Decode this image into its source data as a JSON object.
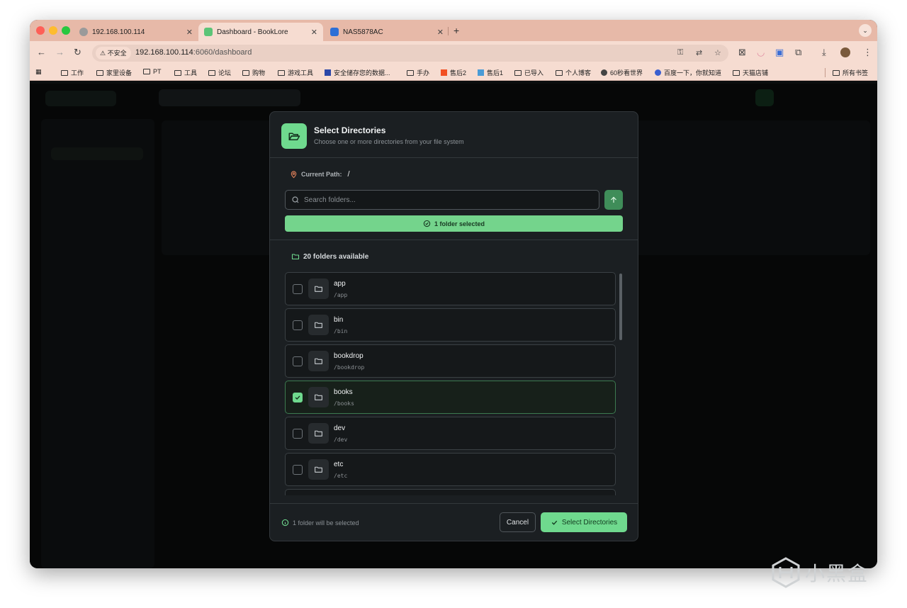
{
  "browser": {
    "tabs": [
      {
        "title": "192.168.100.114",
        "favicon": "globe-icon"
      },
      {
        "title": "Dashboard - BookLore",
        "favicon": "booklore-icon"
      },
      {
        "title": "NAS5878AC",
        "favicon": "nas-icon"
      }
    ],
    "new_tab": "+",
    "address": {
      "security_label": "不安全",
      "url_host": "192.168.100.114",
      "url_rest": ":6060/dashboard"
    },
    "bookmarks": [
      "工作",
      "家里设备",
      "PT",
      "工具",
      "论坛",
      "购物",
      "游戏工具",
      "安全储存您的数据...",
      "手办",
      "售后2",
      "售后1",
      "已导入",
      "个人博客",
      "60秒看世界",
      "百度一下，你就知道",
      "天猫店铺"
    ],
    "all_bookmarks": "所有书签"
  },
  "modal": {
    "title": "Select Directories",
    "subtitle": "Choose one or more directories from your file system",
    "current_path_label": "Current Path:",
    "current_path": "/",
    "search_placeholder": "Search folders...",
    "selected_banner": "1 folder selected",
    "available_label": "20 folders available",
    "folders": [
      {
        "name": "app",
        "path": "/app",
        "checked": false
      },
      {
        "name": "bin",
        "path": "/bin",
        "checked": false
      },
      {
        "name": "bookdrop",
        "path": "/bookdrop",
        "checked": false
      },
      {
        "name": "books",
        "path": "/books",
        "checked": true
      },
      {
        "name": "dev",
        "path": "/dev",
        "checked": false
      },
      {
        "name": "etc",
        "path": "/etc",
        "checked": false
      }
    ],
    "footer_info": "1 folder will be selected",
    "cancel_label": "Cancel",
    "select_label": "Select Directories"
  },
  "colors": {
    "accent": "#6fd98e",
    "modal_bg": "#1b1f22",
    "tabstrip": "#e7b9a8"
  },
  "watermark": "小黑盒"
}
